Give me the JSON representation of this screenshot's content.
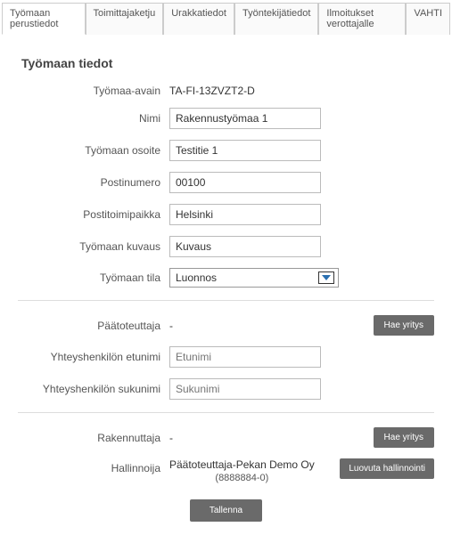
{
  "tabs": [
    {
      "label": "Työmaan perustiedot",
      "active": true
    },
    {
      "label": "Toimittajaketju",
      "active": false
    },
    {
      "label": "Urakkatiedot",
      "active": false
    },
    {
      "label": "Työntekijätiedot",
      "active": false
    },
    {
      "label": "Ilmoitukset verottajalle",
      "active": false
    },
    {
      "label": "VAHTI",
      "active": false
    }
  ],
  "section_title": "Työmaan tiedot",
  "fields": {
    "tyomaa_avain_label": "Työmaa-avain",
    "tyomaa_avain_value": "TA-FI-13ZVZT2-D",
    "nimi_label": "Nimi",
    "nimi_value": "Rakennustyömaa 1",
    "osoite_label": "Työmaan osoite",
    "osoite_value": "Testitie 1",
    "postinumero_label": "Postinumero",
    "postinumero_value": "00100",
    "postitoimipaikka_label": "Postitoimipaikka",
    "postitoimipaikka_value": "Helsinki",
    "kuvaus_label": "Työmaan kuvaus",
    "kuvaus_value": "Kuvaus",
    "tila_label": "Työmaan tila",
    "tila_value": "Luonnos",
    "paatoteuttaja_label": "Päätoteuttaja",
    "paatoteuttaja_value": "-",
    "etunimi_label": "Yhteyshenkilön etunimi",
    "etunimi_placeholder": "Etunimi",
    "sukunimi_label": "Yhteyshenkilön sukunimi",
    "sukunimi_placeholder": "Sukunimi",
    "rakennuttaja_label": "Rakennuttaja",
    "rakennuttaja_value": "-",
    "hallinnoija_label": "Hallinnoija",
    "hallinnoija_value": "Päätoteuttaja-Pekan Demo Oy",
    "hallinnoija_sub": "(8888884-0)"
  },
  "buttons": {
    "hae_yritys": "Hae yritys",
    "luovuta": "Luovuta hallinnointi",
    "tallenna": "Tallenna"
  }
}
